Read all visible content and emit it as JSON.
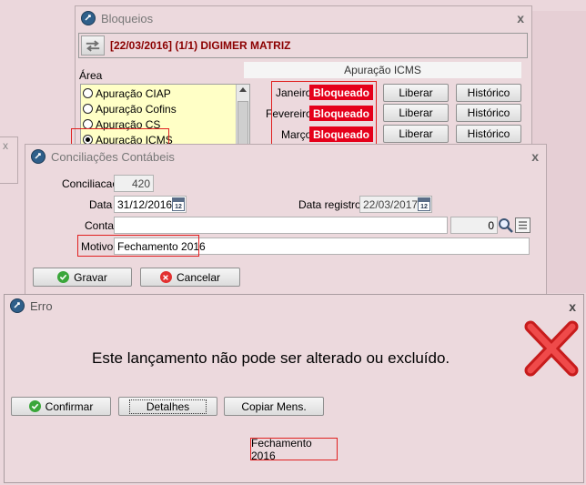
{
  "bloqueios": {
    "title": "Bloqueios",
    "close": "x",
    "header_text": "[22/03/2016] (1/1) DIGIMER MATRIZ",
    "area_label": "Área",
    "area_items": [
      "Apuração CIAP",
      "Apuração Cofins",
      "Apuração CS",
      "Apuração ICMS"
    ],
    "selected_area": "Apuração ICMS",
    "section_header": "Apuração ICMS",
    "months": [
      {
        "name": "Janeiro",
        "status": "Bloqueado",
        "liberar": "Liberar",
        "historico": "Histórico"
      },
      {
        "name": "Fevereiro",
        "status": "Bloqueado",
        "liberar": "Liberar",
        "historico": "Histórico"
      },
      {
        "name": "Março",
        "status": "Bloqueado",
        "liberar": "Liberar",
        "historico": "Histórico"
      }
    ]
  },
  "conciliacoes": {
    "title": "Conciliações Contábeis",
    "close": "x",
    "conciliacao_label": "Conciliacao",
    "conciliacao_value": "420",
    "data_label": "Data",
    "data_value": "31/12/2016",
    "data_registro_label": "Data registro",
    "data_registro_value": "22/03/2017",
    "conta_label": "Conta",
    "conta_value": "",
    "conta_number": "0",
    "motivo_label": "Motivo",
    "motivo_value": "Fechamento 2016",
    "gravar": "Gravar",
    "cancelar": "Cancelar"
  },
  "erro": {
    "title": "Erro",
    "close": "x",
    "message": "Este lançamento não pode ser alterado ou excluído.",
    "confirmar": "Confirmar",
    "detalhes": "Detalhes",
    "copiar": "Copiar Mens.",
    "detail_text": "Fechamento 2016"
  },
  "colors": {
    "window_bg": "#ecd9dd",
    "blocked_red": "#e5001a",
    "highlight_border": "#e02020",
    "header_text": "#8b0000",
    "list_bg": "#ffffc6"
  },
  "icons": [
    "app-icon",
    "swap-arrows-icon",
    "calendar-icon",
    "search-icon",
    "list-icon",
    "check-icon",
    "cancel-icon",
    "error-x-icon"
  ]
}
